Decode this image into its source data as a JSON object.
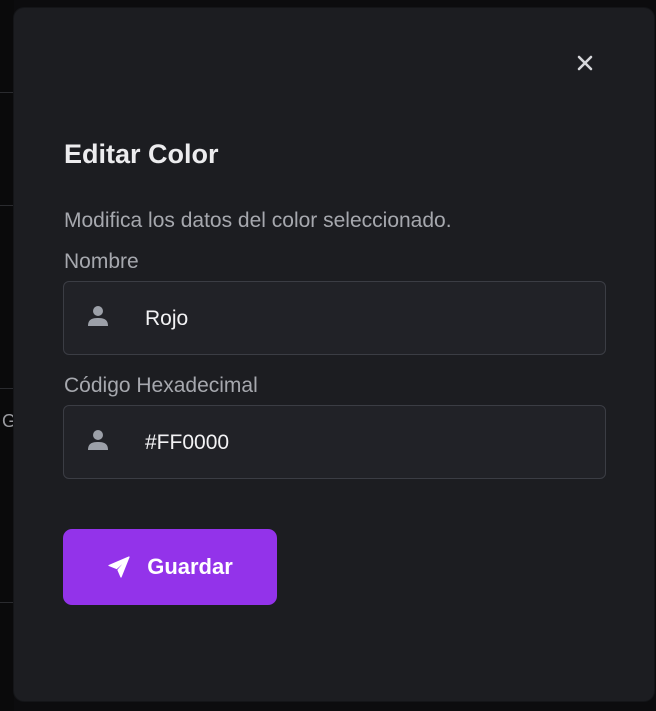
{
  "modal": {
    "title": "Editar Color",
    "description": "Modifica los datos del color seleccionado.",
    "close_icon": "close-icon"
  },
  "form": {
    "fields": [
      {
        "label": "Nombre",
        "value": "Rojo",
        "icon": "user-icon"
      },
      {
        "label": "Código Hexadecimal",
        "value": "#FF0000",
        "icon": "user-icon"
      }
    ],
    "submit": {
      "label": "Guardar",
      "icon": "paper-plane-icon"
    }
  },
  "background": {
    "glyph": "G"
  },
  "colors": {
    "modal_background": "#1c1d21",
    "input_background": "#212227",
    "input_border": "#3b3d44",
    "accent": "#9333ea",
    "title_text": "#ececee",
    "muted_text": "#a6a8ae",
    "icon": "#9ca0a8"
  }
}
